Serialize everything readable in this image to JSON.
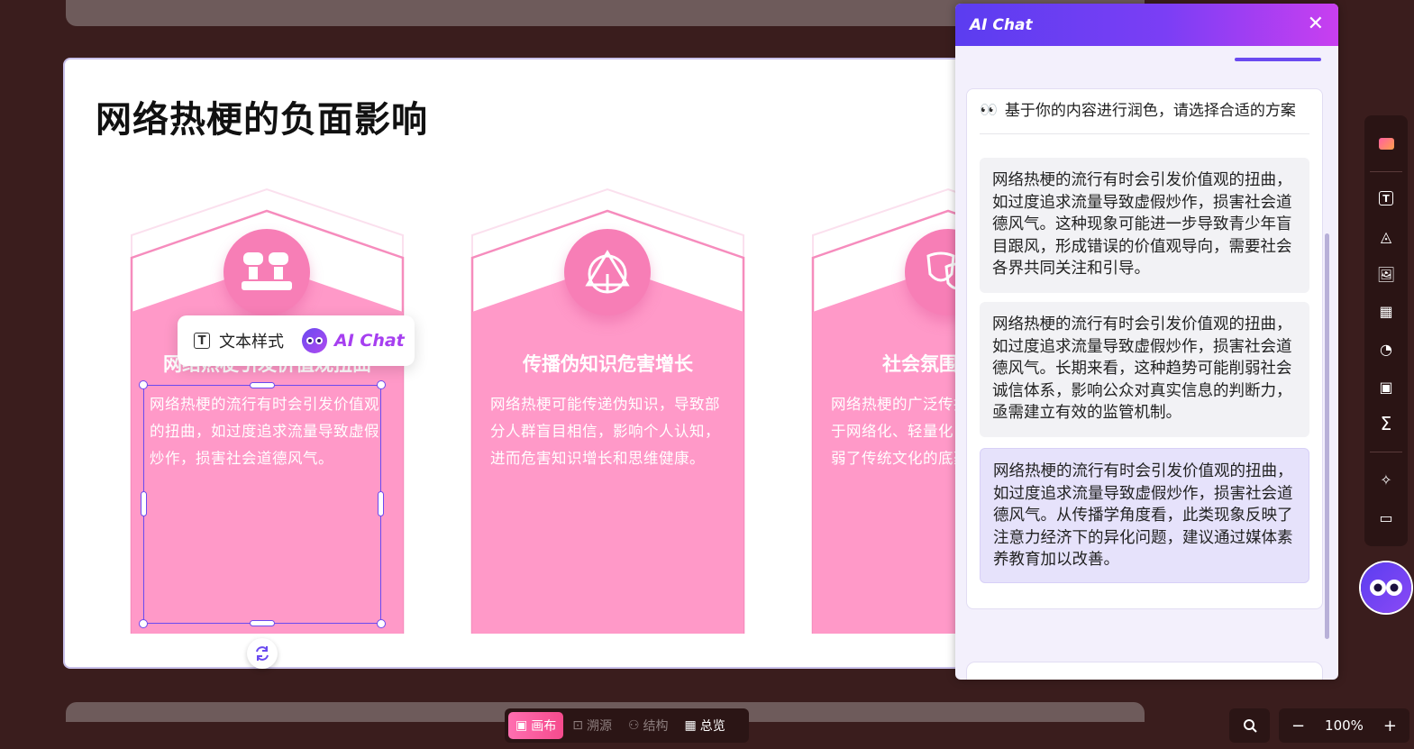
{
  "slide": {
    "title": "网络热梗的负面影响",
    "cards": [
      {
        "heading": "网络热梗引发价值观扭曲",
        "body": "网络热梗的流行有时会引发价值观的扭曲，如过度追求流量导致虚假炒作，损害社会道德风气。",
        "icon": "people-icon"
      },
      {
        "heading": "传播伪知识危害增长",
        "body": "网络热梗可能传递伪知识，导致部分人群盲目相信，影响个人认知，进而危害知识增长和思维健康。",
        "icon": "pyramid-icon"
      },
      {
        "heading": "社会氛围网络化",
        "body": "网络热梗的广泛传播使社会氛围趋于网络化、轻量化，缺乏深度，削弱了传统文化的底蕴。",
        "icon": "theater-mask-icon"
      }
    ]
  },
  "floating_toolbar": {
    "text_style_label": "文本样式",
    "ai_chat_label": "AI Chat"
  },
  "ai_panel": {
    "title": "AI Chat",
    "prompt": "基于你的内容进行润色，请选择合适的方案",
    "options": [
      "网络热梗的流行有时会引发价值观的扭曲，如过度追求流量导致虚假炒作，损害社会道德风气。这种现象可能进一步导致青少年盲目跟风，形成错误的价值观导向，需要社会各界共同关注和引导。",
      "网络热梗的流行有时会引发价值观的扭曲，如过度追求流量导致虚假炒作，损害社会道德风气。长期来看，这种趋势可能削弱社会诚信体系，影响公众对真实信息的判断力，亟需建立有效的监管机制。",
      "网络热梗的流行有时会引发价值观的扭曲，如过度追求流量导致虚假炒作，损害社会道德风气。从传播学角度看，此类现象反映了注意力经济下的异化问题，建议通过媒体素养教育加以改善。"
    ],
    "selected_option": 2
  },
  "bottom_nav": {
    "tabs": [
      {
        "label": "画布",
        "icon": "canvas-icon"
      },
      {
        "label": "溯源",
        "icon": "trace-icon"
      },
      {
        "label": "结构",
        "icon": "structure-icon"
      },
      {
        "label": "总览",
        "icon": "grid-icon"
      }
    ]
  },
  "zoom": {
    "level": "100%",
    "minus": "−",
    "plus": "+"
  },
  "colors": {
    "card_pink": "#ff99c8",
    "accent_purple": "#6a4af0",
    "background": "#3a1d1d"
  }
}
